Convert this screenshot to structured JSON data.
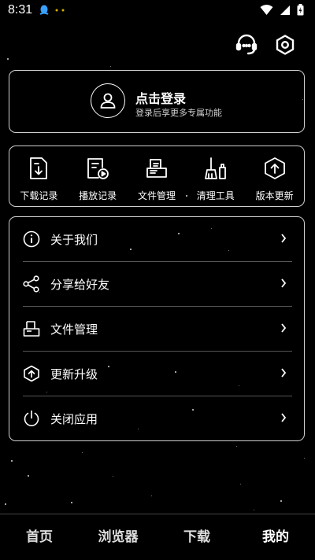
{
  "status": {
    "time": "8:31"
  },
  "login": {
    "title": "点击登录",
    "subtitle": "登录后享更多专属功能"
  },
  "tools": [
    {
      "label": "下载记录",
      "icon": "download-record-icon"
    },
    {
      "label": "播放记录",
      "icon": "play-record-icon"
    },
    {
      "label": "文件管理",
      "icon": "file-manager-icon"
    },
    {
      "label": "清理工具",
      "icon": "clean-tool-icon"
    },
    {
      "label": "版本更新",
      "icon": "version-update-icon"
    }
  ],
  "menu": [
    {
      "label": "关于我们",
      "icon": "info-icon"
    },
    {
      "label": "分享给好友",
      "icon": "share-icon"
    },
    {
      "label": "文件管理",
      "icon": "file-manager-icon"
    },
    {
      "label": "更新升级",
      "icon": "upgrade-icon"
    },
    {
      "label": "关闭应用",
      "icon": "power-icon"
    }
  ],
  "nav": [
    {
      "label": "首页"
    },
    {
      "label": "浏览器"
    },
    {
      "label": "下载"
    },
    {
      "label": "我的",
      "active": true
    }
  ],
  "colors": {
    "background": "#000000",
    "foreground": "#ffffff",
    "border": "#cfcfcf"
  }
}
